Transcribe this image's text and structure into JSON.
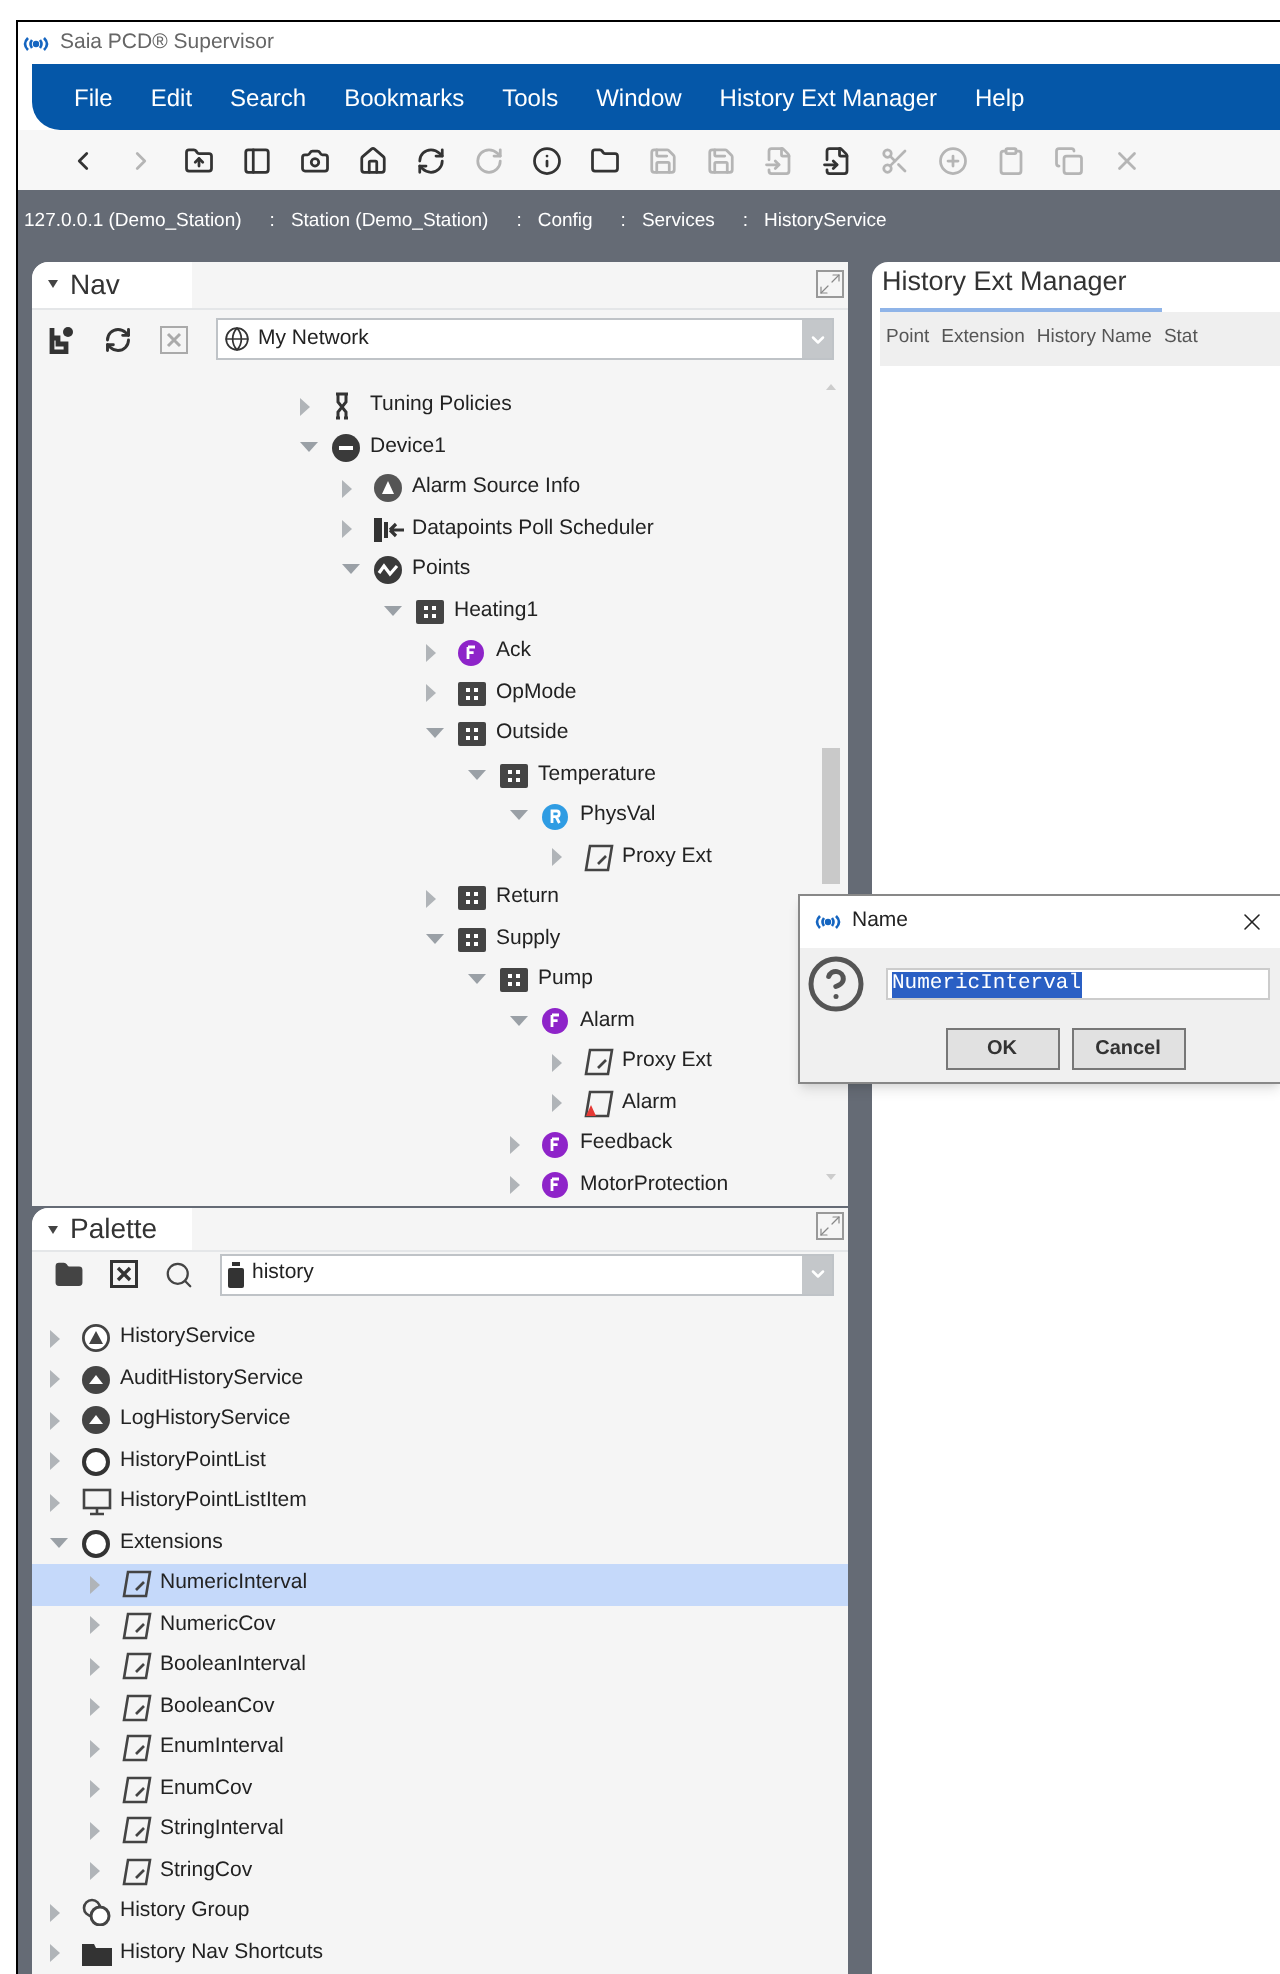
{
  "window": {
    "title": "Saia PCD® Supervisor"
  },
  "menu": [
    "File",
    "Edit",
    "Search",
    "Bookmarks",
    "Tools",
    "Window",
    "History Ext Manager",
    "Help"
  ],
  "breadcrumb": {
    "separator": ":",
    "items": [
      "127.0.0.1 (Demo_Station)",
      "Station (Demo_Station)",
      "Config",
      "Services",
      "HistoryService"
    ]
  },
  "nav": {
    "title": "Nav",
    "expanded": true,
    "dropdown": "My Network",
    "tree": [
      {
        "label": "Tuning Policies",
        "kind": "tuning",
        "expanded": false
      },
      {
        "label": "Device1",
        "kind": "device",
        "expanded": true,
        "children": [
          {
            "label": "Alarm Source Info",
            "kind": "alarm-source",
            "expanded": false
          },
          {
            "label": "Datapoints Poll Scheduler",
            "kind": "poll",
            "expanded": false
          },
          {
            "label": "Points",
            "kind": "points",
            "expanded": true,
            "children": [
              {
                "label": "Heating1",
                "kind": "folder",
                "expanded": true,
                "children": [
                  {
                    "label": "Ack",
                    "kind": "f-point",
                    "expanded": false
                  },
                  {
                    "label": "OpMode",
                    "kind": "folder",
                    "expanded": false
                  },
                  {
                    "label": "Outside",
                    "kind": "folder",
                    "expanded": true,
                    "children": [
                      {
                        "label": "Temperature",
                        "kind": "folder",
                        "expanded": true,
                        "children": [
                          {
                            "label": "PhysVal",
                            "kind": "r-point",
                            "expanded": true,
                            "children": [
                              {
                                "label": "Proxy Ext",
                                "kind": "ext",
                                "expanded": false
                              }
                            ]
                          }
                        ]
                      }
                    ]
                  },
                  {
                    "label": "Return",
                    "kind": "folder",
                    "expanded": false
                  },
                  {
                    "label": "Supply",
                    "kind": "folder",
                    "expanded": true,
                    "children": [
                      {
                        "label": "Pump",
                        "kind": "folder",
                        "expanded": true,
                        "children": [
                          {
                            "label": "Alarm",
                            "kind": "f-point",
                            "expanded": true,
                            "children": [
                              {
                                "label": "Proxy Ext",
                                "kind": "ext",
                                "expanded": false
                              },
                              {
                                "label": "Alarm",
                                "kind": "alarm-ext",
                                "expanded": false
                              }
                            ]
                          },
                          {
                            "label": "Feedback",
                            "kind": "f-point",
                            "expanded": false
                          },
                          {
                            "label": "MotorProtection",
                            "kind": "f-point",
                            "expanded": false
                          }
                        ]
                      }
                    ]
                  }
                ]
              }
            ]
          }
        ]
      }
    ]
  },
  "palette": {
    "title": "Palette",
    "expanded": true,
    "dropdown": "history",
    "tree": [
      {
        "label": "HistoryService",
        "kind": "service",
        "expanded": false,
        "selected": false
      },
      {
        "label": "AuditHistoryService",
        "kind": "service2",
        "expanded": false,
        "selected": false
      },
      {
        "label": "LogHistoryService",
        "kind": "service2",
        "expanded": false,
        "selected": false
      },
      {
        "label": "HistoryPointList",
        "kind": "list",
        "expanded": false,
        "selected": false
      },
      {
        "label": "HistoryPointListItem",
        "kind": "listitem",
        "expanded": false,
        "selected": false
      },
      {
        "label": "Extensions",
        "kind": "list",
        "expanded": true,
        "selected": false,
        "children": [
          {
            "label": "NumericInterval",
            "kind": "ext",
            "expanded": false,
            "selected": true
          },
          {
            "label": "NumericCov",
            "kind": "ext",
            "expanded": false,
            "selected": false
          },
          {
            "label": "BooleanInterval",
            "kind": "ext",
            "expanded": false,
            "selected": false
          },
          {
            "label": "BooleanCov",
            "kind": "ext",
            "expanded": false,
            "selected": false
          },
          {
            "label": "EnumInterval",
            "kind": "ext",
            "expanded": false,
            "selected": false
          },
          {
            "label": "EnumCov",
            "kind": "ext",
            "expanded": false,
            "selected": false
          },
          {
            "label": "StringInterval",
            "kind": "ext",
            "expanded": false,
            "selected": false
          },
          {
            "label": "StringCov",
            "kind": "ext",
            "expanded": false,
            "selected": false
          }
        ]
      },
      {
        "label": "History Group",
        "kind": "group",
        "expanded": false,
        "selected": false
      },
      {
        "label": "History Nav Shortcuts",
        "kind": "shortcuts",
        "expanded": false,
        "selected": false
      }
    ]
  },
  "manager": {
    "tab": "History Ext Manager",
    "columns": [
      "Point",
      "Extension",
      "History Name",
      "Stat"
    ]
  },
  "dialog": {
    "title": "Name",
    "value": "NumericInterval",
    "buttons": [
      "OK",
      "Cancel"
    ]
  }
}
